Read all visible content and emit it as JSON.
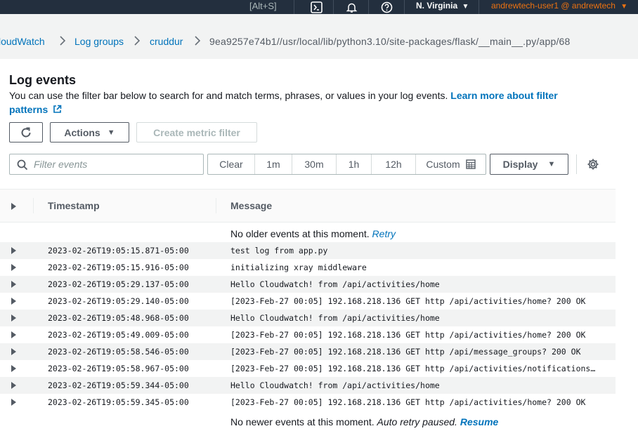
{
  "topbar": {
    "shortcut": "[Alt+S]",
    "region": "N. Virginia",
    "account": "andrewtech-user1 @ andrewtech"
  },
  "breadcrumb": {
    "items": [
      "loudWatch",
      "Log groups",
      "cruddur"
    ],
    "current": "9ea9257e74b1//usr/local/lib/python3.10/site-packages/flask/__main__.py/app/68"
  },
  "panel": {
    "title": "Log events",
    "description": "You can use the filter bar below to search for and match terms, phrases, or values in your log events.",
    "learn_more": "Learn more about filter patterns",
    "actions_label": "Actions",
    "create_metric_label": "Create metric filter",
    "filter_placeholder": "Filter events",
    "time_ranges": [
      "Clear",
      "1m",
      "30m",
      "1h",
      "12h",
      "Custom"
    ],
    "display_label": "Display"
  },
  "table": {
    "columns": [
      "Timestamp",
      "Message"
    ],
    "no_older": "No older events at this moment.",
    "retry": "Retry",
    "no_newer": "No newer events at this moment.",
    "auto_retry": "Auto retry paused.",
    "resume": "Resume",
    "rows": [
      {
        "timestamp": "2023-02-26T19:05:15.871-05:00",
        "message": "test log from app.py"
      },
      {
        "timestamp": "2023-02-26T19:05:15.916-05:00",
        "message": "initializing xray middleware"
      },
      {
        "timestamp": "2023-02-26T19:05:29.137-05:00",
        "message": "Hello Cloudwatch! from /api/activities/home"
      },
      {
        "timestamp": "2023-02-26T19:05:29.140-05:00",
        "message": "[2023-Feb-27 00:05] 192.168.218.136 GET http /api/activities/home? 200 OK"
      },
      {
        "timestamp": "2023-02-26T19:05:48.968-05:00",
        "message": "Hello Cloudwatch! from /api/activities/home"
      },
      {
        "timestamp": "2023-02-26T19:05:49.009-05:00",
        "message": "[2023-Feb-27 00:05] 192.168.218.136 GET http /api/activities/home? 200 OK"
      },
      {
        "timestamp": "2023-02-26T19:05:58.546-05:00",
        "message": "[2023-Feb-27 00:05] 192.168.218.136 GET http /api/message_groups? 200 OK"
      },
      {
        "timestamp": "2023-02-26T19:05:58.967-05:00",
        "message": "[2023-Feb-27 00:05] 192.168.218.136 GET http /api/activities/notifications…"
      },
      {
        "timestamp": "2023-02-26T19:05:59.344-05:00",
        "message": "Hello Cloudwatch! from /api/activities/home"
      },
      {
        "timestamp": "2023-02-26T19:05:59.345-05:00",
        "message": "[2023-Feb-27 00:05] 192.168.218.136 GET http /api/activities/home? 200 OK"
      }
    ]
  },
  "colors": {
    "nav_bg": "#232f3e",
    "link": "#0073bb",
    "account": "#ec7211"
  }
}
